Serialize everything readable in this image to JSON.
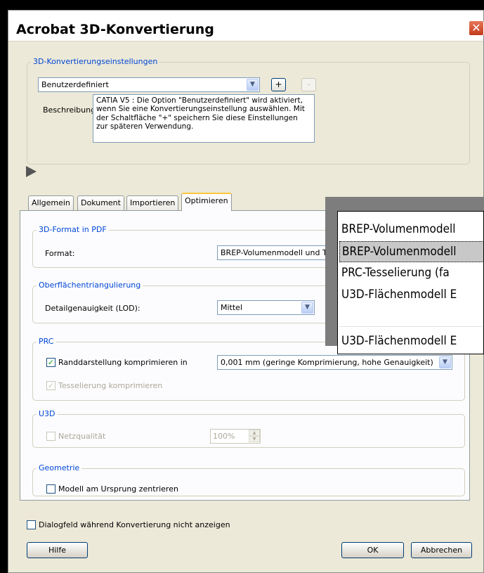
{
  "window": {
    "title": "Acrobat 3D-Konvertierung",
    "close_glyph": "✕"
  },
  "settings_group": {
    "title": "3D-Konvertierungseinstellungen",
    "preset_value": "Benutzerdefiniert",
    "add_label": "+",
    "remove_label": "-",
    "description_label": "Beschreibung",
    "description_text": "CATIA V5 : Die Option \"Benutzerdefiniert\" wird aktiviert, wenn Sie eine Konvertierungseinstellung auswählen. Mit der Schaltfläche \"+\" speichern Sie diese Einstellungen zur späteren Verwendung."
  },
  "tabs": [
    {
      "label": "Allgemein"
    },
    {
      "label": "Dokument"
    },
    {
      "label": "Importieren"
    },
    {
      "label": "Optimieren",
      "active": true
    }
  ],
  "format_group": {
    "title": "3D-Format in PDF",
    "format_label": "Format:",
    "format_value": "BREP-Volumenmodell und Tesselierung"
  },
  "triangulation_group": {
    "title": "Oberflächentriangulierung",
    "lod_label": "Detailgenauigkeit (LOD):",
    "lod_value": "Mittel"
  },
  "prc_group": {
    "title": "PRC",
    "compress_edges_label": "Randdarstellung komprimieren in",
    "compress_edges_checked": true,
    "compress_edges_value": "0,001 mm (geringe Komprimierung, hohe Genauigkeit)",
    "compress_tess_label": "Tesselierung komprimieren",
    "compress_tess_checked": true
  },
  "u3d_group": {
    "title": "U3D",
    "mesh_quality_label": "Netzqualität",
    "mesh_quality_checked": false,
    "mesh_quality_value": "100%"
  },
  "geometry_group": {
    "title": "Geometrie",
    "center_model_label": "Modell am Ursprung zentrieren",
    "center_model_checked": false
  },
  "footer": {
    "no_dialog_label": "Dialogfeld während Konvertierung nicht anzeigen",
    "help_label": "Hilfe",
    "ok_label": "OK",
    "cancel_label": "Abbrechen"
  },
  "format_dropdown": {
    "items": [
      "BREP-Volumenmodell",
      "BREP-Volumenmodell",
      "PRC-Tesselierung (fa",
      "U3D-Flächenmodell E",
      "U3D-Flächenmodell E"
    ],
    "selected_index": 1
  },
  "icons": {
    "checkmark": "✓",
    "chevron_down": "▼",
    "spin_up": "▲",
    "spin_down": "▼"
  }
}
